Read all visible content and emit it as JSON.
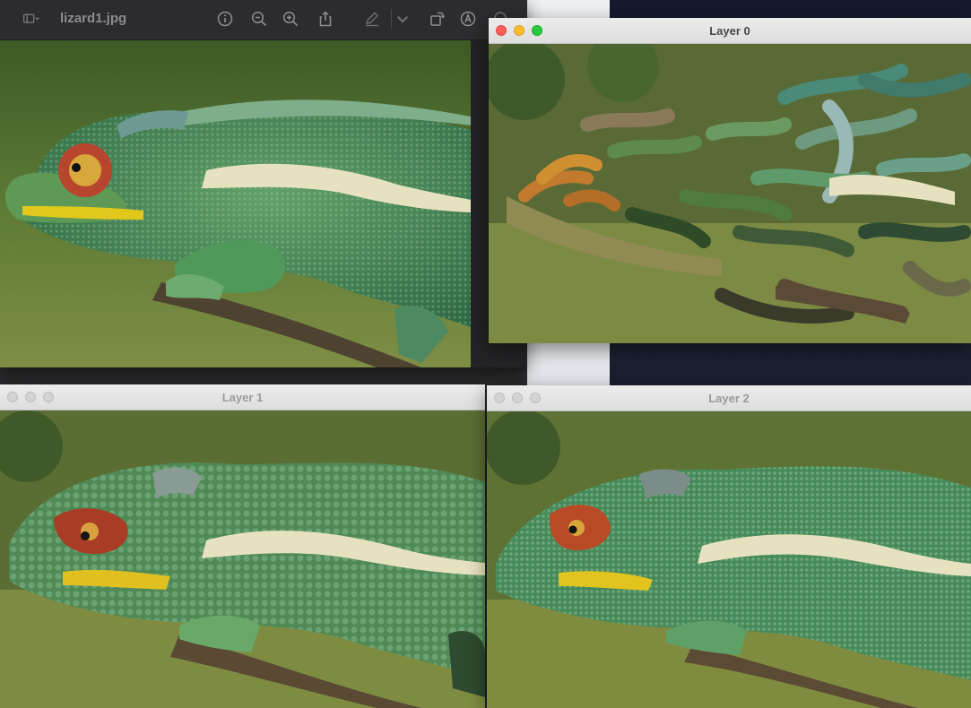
{
  "preview": {
    "title": "lizard1.jpg",
    "toolbar": {
      "sidebar_icon": "sidebar-icon",
      "info_icon": "info-icon",
      "zoom_out_icon": "zoom-out-icon",
      "zoom_in_icon": "zoom-in-icon",
      "share_icon": "share-icon",
      "markup_icon": "markup-pen-icon",
      "rotate_icon": "rotate-icon",
      "annotate_icon": "annotate-icon"
    }
  },
  "windows": [
    {
      "title": "Layer 0",
      "active": true
    },
    {
      "title": "Layer 1",
      "active": false
    },
    {
      "title": "Layer 2",
      "active": false
    }
  ],
  "colors": {
    "close": "#ff5f57",
    "minimize": "#febc2e",
    "zoom": "#28c840",
    "background_green": "#6f8a3c",
    "lizard_green": "#4d8a52",
    "stripe": "#e6e2bf",
    "eye_red": "#b8452e",
    "lip_yellow": "#e2c81c",
    "branch": "#5a4a36"
  }
}
